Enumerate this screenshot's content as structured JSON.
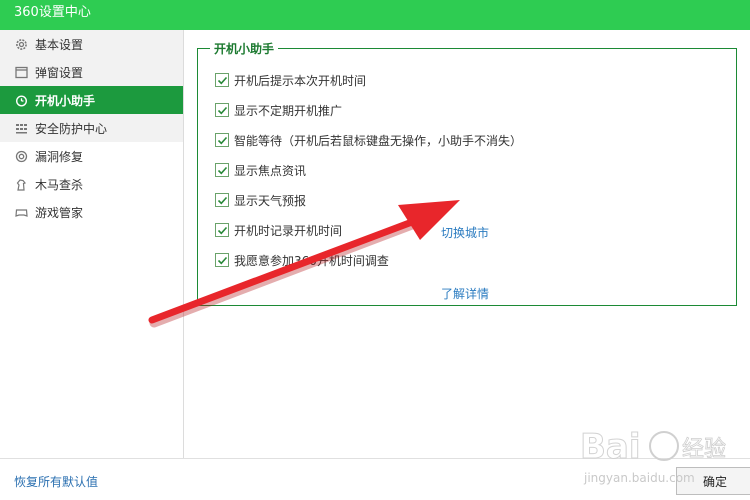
{
  "window": {
    "title": "360设置中心"
  },
  "sidebar": {
    "items": [
      {
        "label": "基本设置",
        "icon": "gear-icon"
      },
      {
        "label": "弹窗设置",
        "icon": "window-icon"
      },
      {
        "label": "开机小助手",
        "icon": "clock-icon",
        "active": true
      },
      {
        "label": "安全防护中心",
        "icon": "grid-icon"
      },
      {
        "label": "漏洞修复",
        "icon": "target-icon"
      },
      {
        "label": "木马查杀",
        "icon": "horse-icon"
      },
      {
        "label": "游戏管家",
        "icon": "gamepad-icon"
      }
    ]
  },
  "main": {
    "group_title": "开机小助手",
    "options": [
      {
        "label": "开机后提示本次开机时间",
        "checked": true
      },
      {
        "label": "显示不定期开机推广",
        "checked": true
      },
      {
        "label": "智能等待（开机后若鼠标键盘无操作，小助手不消失）",
        "checked": true
      },
      {
        "label": "显示焦点资讯",
        "checked": true
      },
      {
        "label": "显示天气预报",
        "checked": true
      },
      {
        "label": "开机时记录开机时间",
        "checked": true
      },
      {
        "label": "我愿意参加360开机时间调查",
        "checked": true
      }
    ],
    "switch_city_link": "切换城市",
    "learn_more_link": "了解详情"
  },
  "footer": {
    "restore_defaults": "恢复所有默认值",
    "ok_button": "确定"
  },
  "watermark": {
    "logo": "Bai",
    "brand": "经验",
    "url": "jingyan.baidu.com"
  },
  "colors": {
    "titlebar": "#2ecc52",
    "active": "#1c9a3e",
    "arrow": "#e8262b",
    "link": "#2a7bc0"
  }
}
